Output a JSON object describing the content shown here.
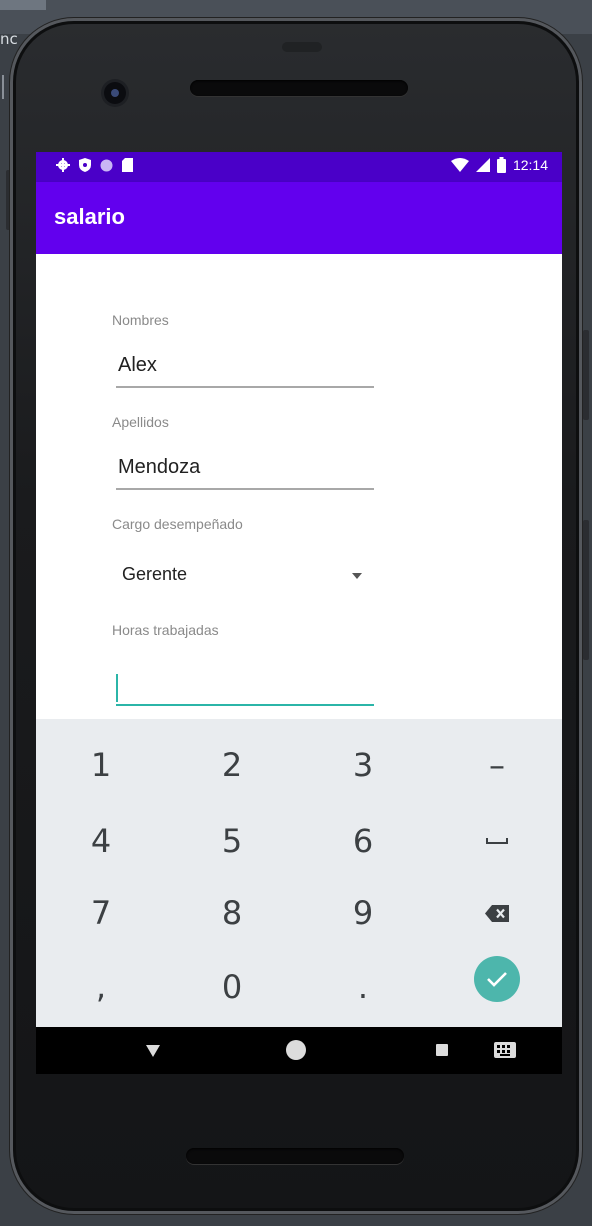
{
  "desktop": {
    "partial_label": "nc"
  },
  "statusbar": {
    "time": "12:14",
    "left_icons": [
      "gear-icon",
      "shield-icon",
      "circle-icon",
      "sd-card-icon"
    ],
    "right_icons": [
      "wifi-icon",
      "signal-icon",
      "battery-icon"
    ]
  },
  "appbar": {
    "title": "salario",
    "color": "#6200ee",
    "status_color": "#4a00c8"
  },
  "form": {
    "nombres": {
      "label": "Nombres",
      "value": "Alex"
    },
    "apellidos": {
      "label": "Apellidos",
      "value": "Mendoza"
    },
    "cargo": {
      "label": "Cargo desempeñado",
      "selected": "Gerente"
    },
    "horas": {
      "label": "Horas trabajadas",
      "value": ""
    },
    "accent": "#2bb5a8"
  },
  "keyboard": {
    "keys": [
      "1",
      "2",
      "3",
      "–",
      "4",
      "5",
      "6",
      "space-icon",
      "7",
      "8",
      "9",
      "backspace-icon",
      ",",
      "0",
      ".",
      "done-check-icon"
    ],
    "k1": "1",
    "k2": "2",
    "k3": "3",
    "kdash": "–",
    "k4": "4",
    "k5": "5",
    "k6": "6",
    "k7": "7",
    "k8": "8",
    "k9": "9",
    "kcomma": ",",
    "k0": "0",
    "kdot": ".",
    "done_color": "#4db6ac"
  },
  "navbar": {
    "icons": [
      "back-icon",
      "home-icon",
      "recents-icon",
      "keyboard-switch-icon"
    ]
  }
}
